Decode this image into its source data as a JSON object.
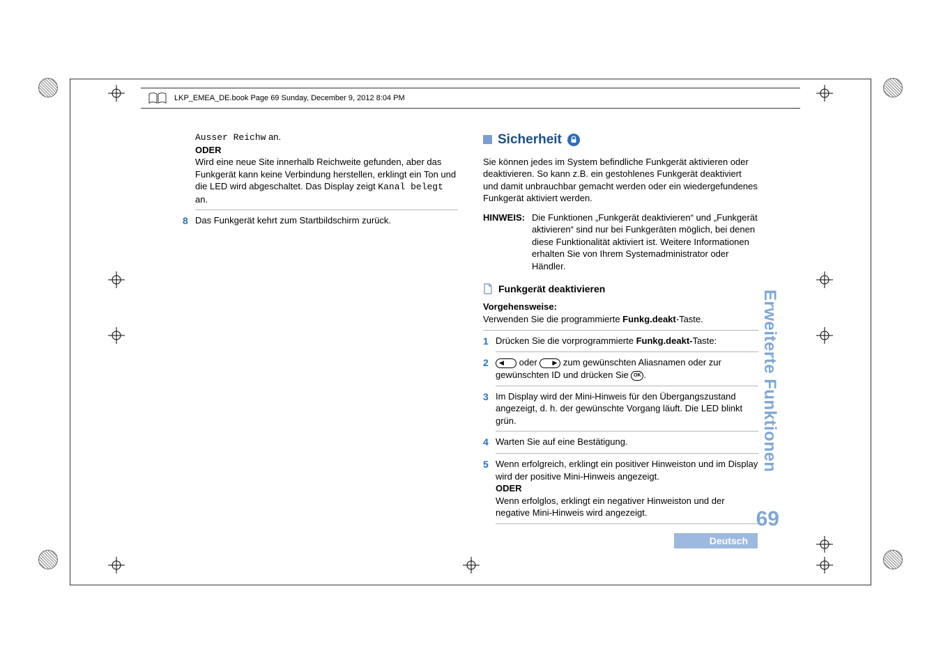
{
  "running_head": "LKP_EMEA_DE.book  Page 69  Sunday, December 9, 2012  8:04 PM",
  "side_tab": "Erweiterte Funktionen",
  "page_number": "69",
  "language": "Deutsch",
  "left": {
    "frag_pre": "Ausser Reichw",
    "frag_post": " an.",
    "oder": "ODER",
    "p1a": "Wird eine neue Site innerhalb Reichweite gefunden, aber das Funkgerät kann keine Verbindung herstellen, erklingt ein Ton und die LED wird abgeschaltet. Das Display zeigt ",
    "p1_code": "Kanal belegt",
    "p1b": " an.",
    "step8_num": "8",
    "step8": "Das Funkgerät kehrt zum Startbildschirm zurück."
  },
  "right": {
    "title": "Sicherheit",
    "intro": "Sie können jedes im System befindliche Funkgerät aktivieren oder deaktivieren. So kann z.B. ein gestohlenes Funkgerät deaktiviert und damit unbrauchbar gemacht werden oder ein wiedergefundenes Funkgerät aktiviert werden.",
    "hinweis_label": "HINWEIS:",
    "hinweis_body": "Die Funktionen „Funkgerät deaktivieren“ und „Funkgerät aktivieren“ sind nur bei Funkgeräten möglich, bei denen diese Funktionalität aktiviert ist. Weitere Informationen erhalten Sie von Ihrem Systemadministrator oder Händler.",
    "sub_title": "Funkgerät deaktivieren",
    "vorgehen_label": "Vorgehensweise:",
    "vorgehen_a": "Verwenden Sie die programmierte ",
    "vorgehen_bold": "Funkg.deakt",
    "vorgehen_b": "-Taste.",
    "s1_num": "1",
    "s1_a": "Drücken Sie die vorprogrammierte ",
    "s1_bold": "Funkg.deakt-",
    "s1_b": "Taste:",
    "s2_num": "2",
    "s2_mid": " oder ",
    "s2_tail_a": " zum gewünschten Aliasnamen oder zur gewünschten ID und drücken Sie ",
    "s2_tail_b": ".",
    "s3_num": "3",
    "s3": "Im Display wird der Mini-Hinweis für den Übergangszustand angezeigt, d. h. der gewünschte Vorgang läuft. Die LED blinkt grün.",
    "s4_num": "4",
    "s4": "Warten Sie auf eine Bestätigung.",
    "s5_num": "5",
    "s5a": "Wenn erfolgreich, erklingt ein positiver Hinweiston und im Display wird der positive Mini-Hinweis angezeigt.",
    "s5_oder": "ODER",
    "s5b": "Wenn erfolglos, erklingt ein negativer Hinweiston und der negative Mini-Hinweis wird angezeigt."
  },
  "icons": {
    "lock": "lock-icon",
    "doc": "document-icon",
    "ok": "OK"
  }
}
